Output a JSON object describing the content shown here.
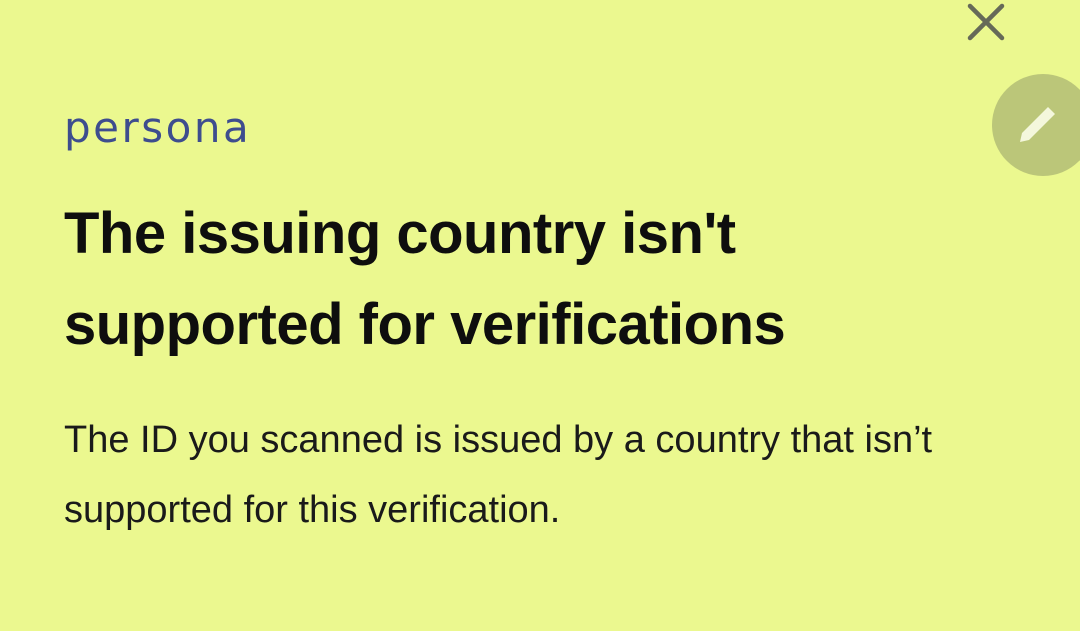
{
  "colors": {
    "background": "#EBF88F",
    "logo": "#3E4D8E",
    "title": "#0E0E0E",
    "body_text": "#1A1A1A",
    "close_icon": "#666A58",
    "edit_button_bg": "#BBC679",
    "edit_icon": "#F4F7DC"
  },
  "icons": {
    "close": "close-icon",
    "edit": "pencil-icon"
  },
  "logo": {
    "text": "persona"
  },
  "error": {
    "title": "The issuing country isn't supported for verifications",
    "message": "The ID you scanned is issued by a country that isn’t supported for this verification."
  }
}
